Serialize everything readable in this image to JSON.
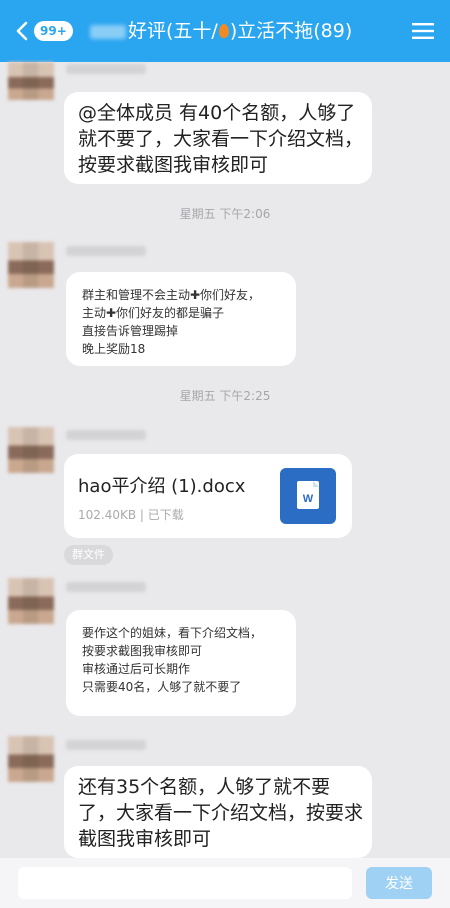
{
  "header": {
    "unread_count": "99+",
    "title_prefix": "好评(五十/",
    "title_suffix": ")立活不拖(89)"
  },
  "messages": [
    {
      "type": "text",
      "lines": [
        "@全体成员 有40个名额，人够了",
        "就不要了，大家看一下介绍文档，",
        "按要求截图我审核即可"
      ]
    },
    {
      "type": "timestamp",
      "text": "星期五 下午2:06"
    },
    {
      "type": "text",
      "lines": [
        "群主和管理不会主动✚你们好友，",
        "主动✚你们好友的都是骗子",
        "直接告诉管理踢掉",
        "晚上奖励18"
      ]
    },
    {
      "type": "timestamp",
      "text": "星期五 下午2:25"
    },
    {
      "type": "file",
      "file_name": "hao平介绍 (1).docx",
      "file_meta": "102.40KB | 已下载",
      "icon": "word-document-icon",
      "icon_letter": "W"
    },
    {
      "type": "tag",
      "text": "群文件"
    },
    {
      "type": "text",
      "lines": [
        "要作这个的姐妹，看下介绍文档，",
        "按要求截图我审核即可",
        "审核通过后可长期作",
        "只需要40名，人够了就不要了"
      ]
    },
    {
      "type": "text",
      "lines": [
        "还有35个名额，人够了就不要",
        "了，大家看一下介绍文档，按要求",
        "截图我审核即可"
      ]
    }
  ],
  "input_bar": {
    "placeholder": "",
    "send_label": "发送"
  },
  "colors": {
    "header": "#2aa5f0",
    "background": "#e9e9ec",
    "bubble": "#ffffff",
    "send_button": "#9fd1f4",
    "word_icon": "#2b6cc4"
  }
}
